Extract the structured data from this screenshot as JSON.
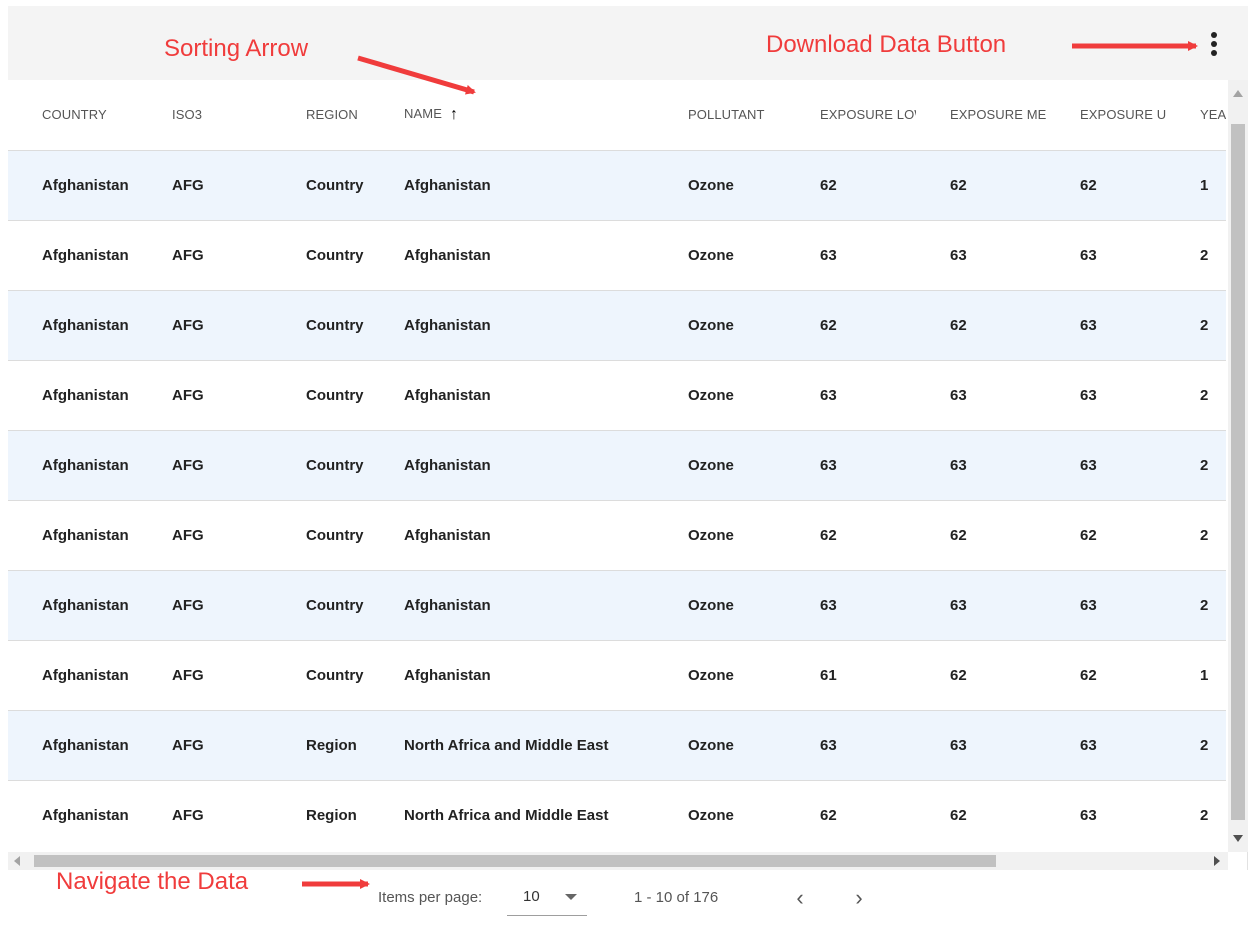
{
  "annotations": {
    "sorting_arrow": "Sorting Arrow",
    "download_button": "Download Data Button",
    "navigate": "Navigate the Data"
  },
  "colors": {
    "annotation_red": "#f03c3c",
    "row_stripe": "#eef5fd",
    "topbar": "#f4f4f4"
  },
  "icons": {
    "menu": "more-vert-icon",
    "sort": "arrow-up-icon",
    "prev": "chevron-left-icon",
    "next": "chevron-right-icon"
  },
  "table": {
    "columns": [
      "COUNTRY",
      "ISO3",
      "REGION",
      "NAME",
      "POLLUTANT",
      "EXPOSURE LOWER",
      "EXPOSURE MEAN",
      "EXPOSURE UPPER",
      "YEAR"
    ],
    "sorted_column": "NAME",
    "sort_direction": "ascending",
    "sort_glyph": "↑",
    "rows": [
      [
        "Afghanistan",
        "AFG",
        "Country",
        "Afghanistan",
        "Ozone",
        "62",
        "62",
        "62",
        "1"
      ],
      [
        "Afghanistan",
        "AFG",
        "Country",
        "Afghanistan",
        "Ozone",
        "63",
        "63",
        "63",
        "2"
      ],
      [
        "Afghanistan",
        "AFG",
        "Country",
        "Afghanistan",
        "Ozone",
        "62",
        "62",
        "63",
        "2"
      ],
      [
        "Afghanistan",
        "AFG",
        "Country",
        "Afghanistan",
        "Ozone",
        "63",
        "63",
        "63",
        "2"
      ],
      [
        "Afghanistan",
        "AFG",
        "Country",
        "Afghanistan",
        "Ozone",
        "63",
        "63",
        "63",
        "2"
      ],
      [
        "Afghanistan",
        "AFG",
        "Country",
        "Afghanistan",
        "Ozone",
        "62",
        "62",
        "62",
        "2"
      ],
      [
        "Afghanistan",
        "AFG",
        "Country",
        "Afghanistan",
        "Ozone",
        "63",
        "63",
        "63",
        "2"
      ],
      [
        "Afghanistan",
        "AFG",
        "Country",
        "Afghanistan",
        "Ozone",
        "61",
        "62",
        "62",
        "1"
      ],
      [
        "Afghanistan",
        "AFG",
        "Region",
        "North Africa and Middle East",
        "Ozone",
        "63",
        "63",
        "63",
        "2"
      ],
      [
        "Afghanistan",
        "AFG",
        "Region",
        "North Africa and Middle East",
        "Ozone",
        "62",
        "62",
        "63",
        "2"
      ]
    ]
  },
  "paginator": {
    "items_per_page_label": "Items per page:",
    "items_per_page_value": "10",
    "range_label": "1 - 10 of 176",
    "prev_glyph": "‹",
    "next_glyph": "›"
  }
}
